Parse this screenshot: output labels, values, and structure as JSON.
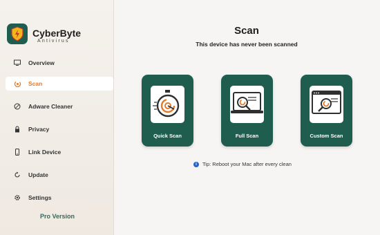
{
  "brand": {
    "name": "CyberByte",
    "subtitle": "Antivirus"
  },
  "sidebar": {
    "items": [
      {
        "label": "Overview",
        "icon": "monitor-icon"
      },
      {
        "label": "Scan",
        "icon": "scan-icon",
        "active": true
      },
      {
        "label": "Adware Cleaner",
        "icon": "block-icon"
      },
      {
        "label": "Privacy",
        "icon": "lock-icon"
      },
      {
        "label": "Link Device",
        "icon": "phone-icon"
      },
      {
        "label": "Update",
        "icon": "refresh-icon"
      },
      {
        "label": "Settings",
        "icon": "gear-icon"
      }
    ],
    "pro_version": "Pro Version"
  },
  "main": {
    "title": "Scan",
    "subtitle": "This device has never been scanned",
    "cards": [
      {
        "label": "Quick Scan",
        "icon": "stopwatch-icon"
      },
      {
        "label": "Full Scan",
        "icon": "laptop-magnifier-icon"
      },
      {
        "label": "Custom Scan",
        "icon": "window-magnifier-icon"
      }
    ],
    "tip": "Tip: Reboot your Mac after every clean"
  },
  "colors": {
    "accent": "#e47a2a",
    "brand_green": "#1f5e4f",
    "close": "#ee5b53"
  }
}
